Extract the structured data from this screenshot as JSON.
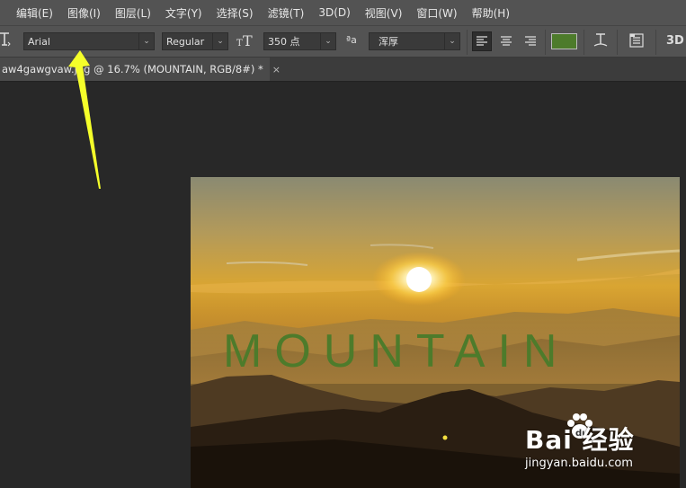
{
  "menu": [
    "编辑(E)",
    "图像(I)",
    "图层(L)",
    "文字(Y)",
    "选择(S)",
    "滤镜(T)",
    "3D(D)",
    "视图(V)",
    "窗口(W)",
    "帮助(H)"
  ],
  "options": {
    "tool_icon": "type-tool-icon",
    "font_family": "Arial",
    "font_style": "Regular",
    "font_size": "350 点",
    "antialias": "浑厚",
    "antialias_glyph": "ªa",
    "text_color": "#4d7b2b",
    "threed_label": "3D"
  },
  "document_tab": {
    "title": "aw4gawgvaw.jpg @ 16.7% (MOUNTAIN, RGB/8#) *",
    "close": "×"
  },
  "canvas": {
    "text_layer": "MOUNTAIN",
    "text_color": "#4d7b2b"
  },
  "watermark": {
    "brand": "Bai 经验",
    "url": "jingyan.baidu.com"
  },
  "annotation": {
    "arrow_color": "#f5ff2a"
  }
}
